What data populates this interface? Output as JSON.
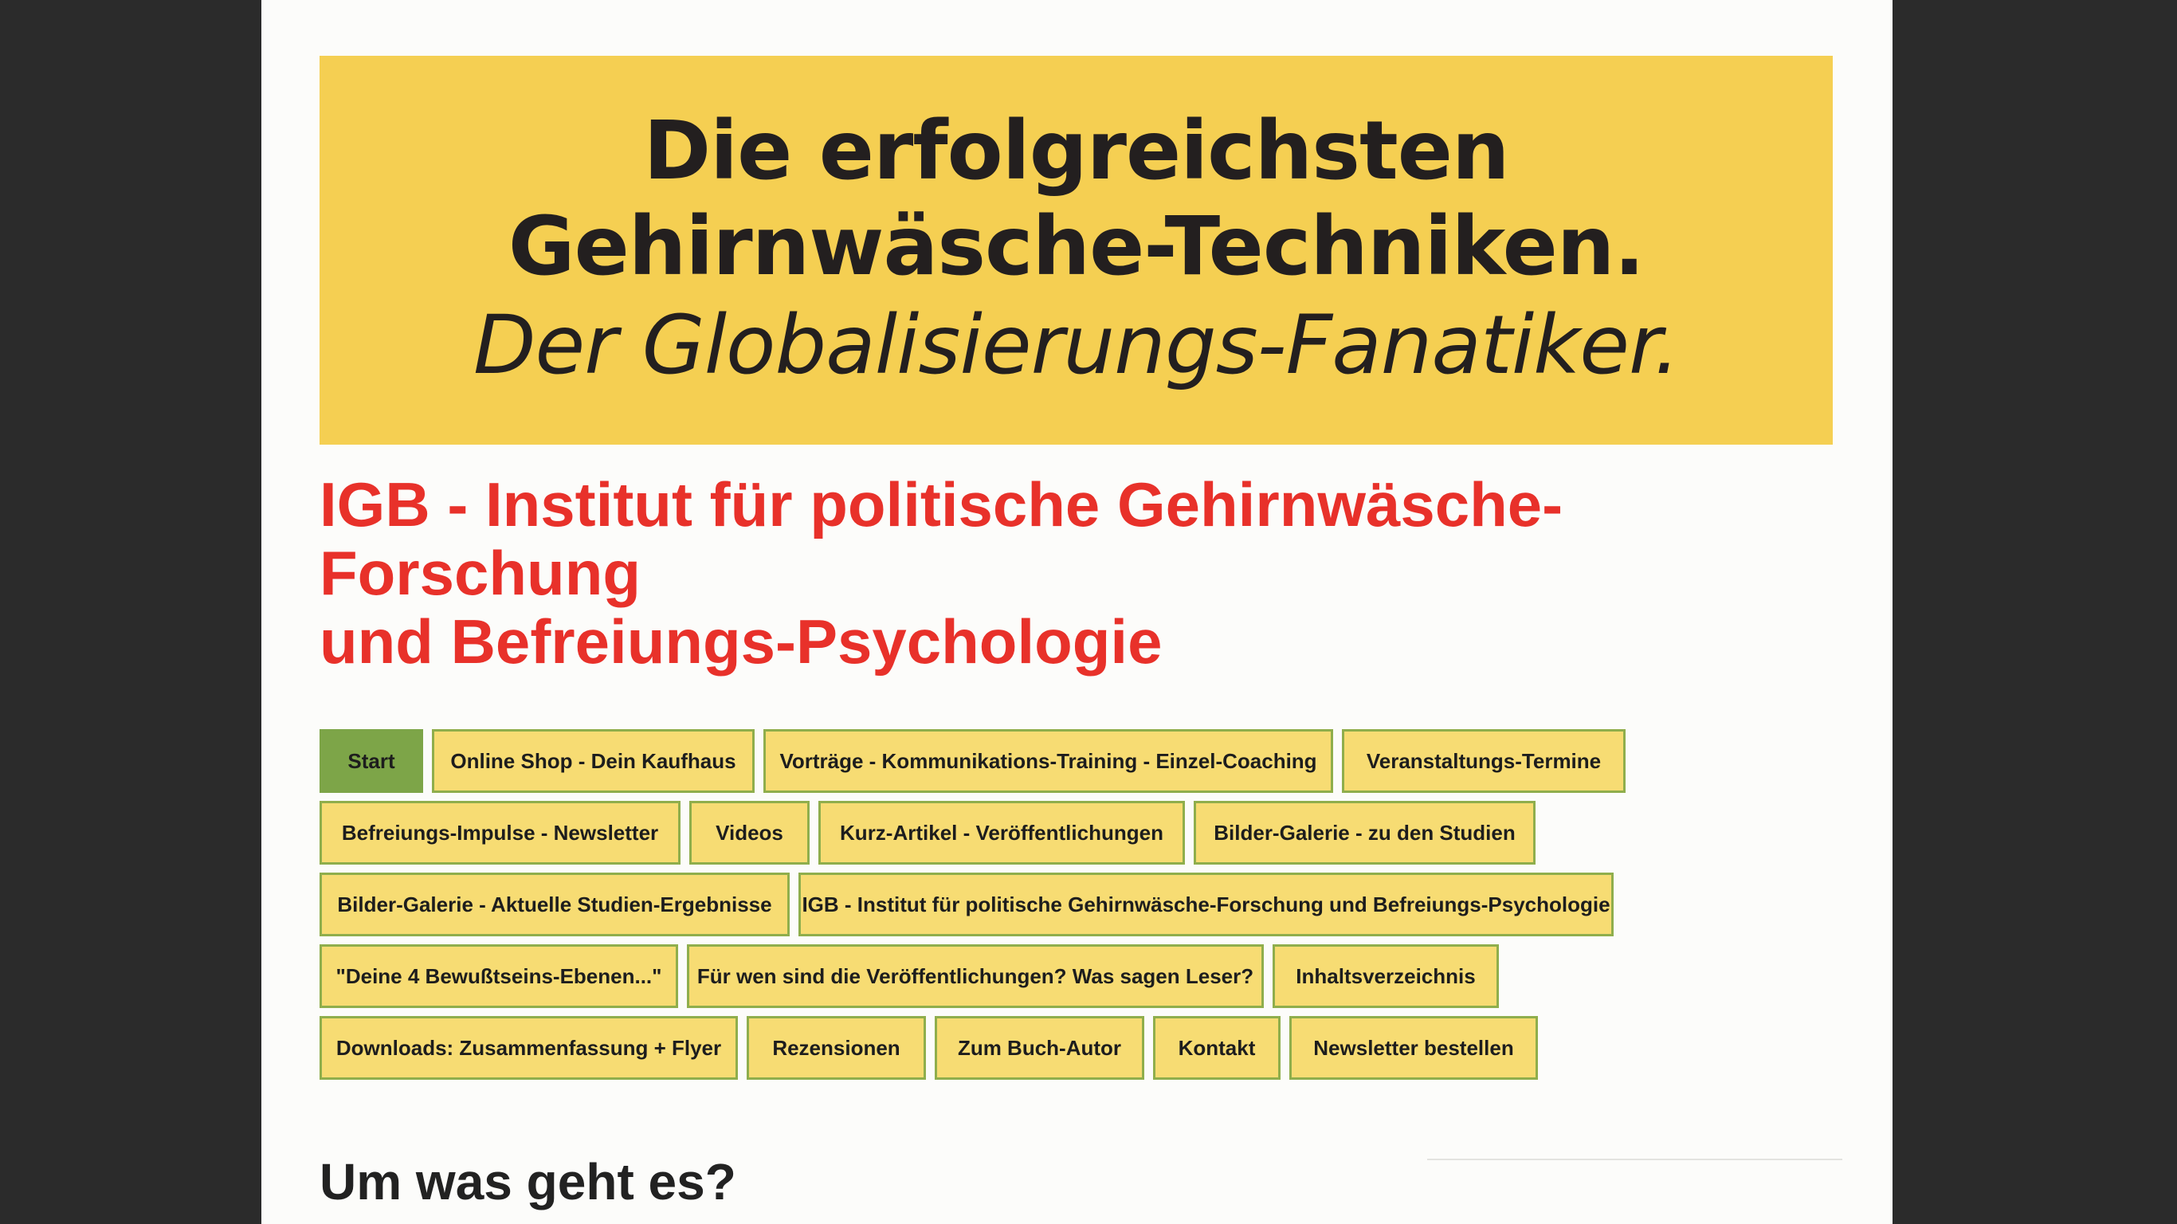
{
  "banner": {
    "line1": "Die erfolgreichsten",
    "line2": "Gehirnwäsche-Techniken.",
    "line3": "Der Globalisierungs-Fanatiker."
  },
  "cart": {
    "icon": "shopping-cart-icon"
  },
  "site_title": {
    "line1": "IGB - Institut für politische Gehirnwäsche-Forschung",
    "line2": "und Befreiungs-Psychologie"
  },
  "nav": {
    "rows": [
      [
        {
          "label": "Start",
          "active": true
        },
        {
          "label": "Online Shop - Dein Kaufhaus"
        },
        {
          "label": "Vorträge - Kommunikations-Training - Einzel-Coaching"
        },
        {
          "label": "Veranstaltungs-Termine"
        }
      ],
      [
        {
          "label": "Befreiungs-Impulse - Newsletter"
        },
        {
          "label": "Videos"
        },
        {
          "label": "Kurz-Artikel - Veröffentlichungen"
        },
        {
          "label": "Bilder-Galerie - zu den Studien"
        }
      ],
      [
        {
          "label": "Bilder-Galerie - Aktuelle Studien-Ergebnisse"
        },
        {
          "label": "IGB - Institut für politische Gehirnwäsche-Forschung und Befreiungs-Psychologie"
        }
      ],
      [
        {
          "label": "\"Deine 4 Bewußtseins-Ebenen...\""
        },
        {
          "label": "Für wen sind die Veröffentlichungen? Was sagen Leser?"
        },
        {
          "label": "Inhaltsverzeichnis"
        }
      ],
      [
        {
          "label": "Downloads: Zusammenfassung + Flyer"
        },
        {
          "label": "Rezensionen"
        },
        {
          "label": "Zum Buch-Autor"
        },
        {
          "label": "Kontakt"
        },
        {
          "label": "Newsletter bestellen"
        }
      ]
    ]
  },
  "section": {
    "heading": "Um was geht es?"
  },
  "colors": {
    "background": "#2b2b2b",
    "page": "#fcfcfa",
    "banner": "#f5cf52",
    "title": "#e8312a",
    "nav_bg": "#f7dc73",
    "nav_border": "#8fae4c",
    "nav_active": "#7da548"
  }
}
